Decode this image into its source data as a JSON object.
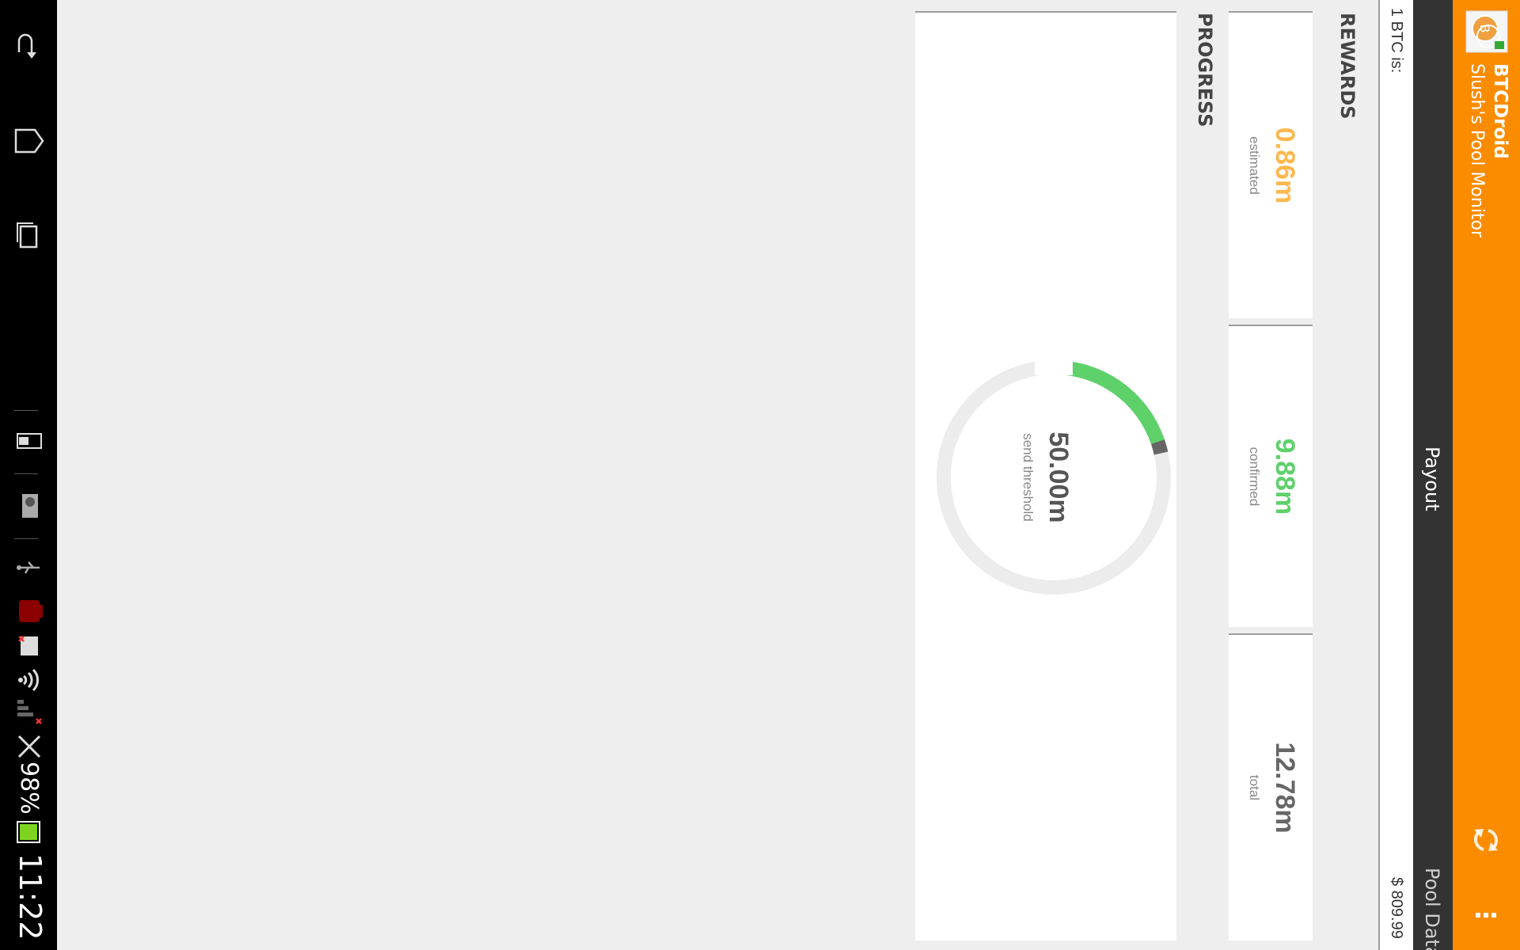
{
  "app": {
    "title": "BTCDroid",
    "subtitle": "Slush's Pool Monitor",
    "accent_color": "#fb8c00",
    "icons": [
      "bitcoin-logo-icon",
      "refresh-icon",
      "overflow-menu-icon"
    ]
  },
  "tabs": [
    {
      "label": "Payout",
      "selected": true
    },
    {
      "label": "Pool Data",
      "selected": false
    }
  ],
  "price": {
    "label": "1 BTC is:",
    "value": "$ 809.99"
  },
  "rewards": {
    "title": "REWARDS",
    "estimated": {
      "value": "0.86m",
      "label": "estimated",
      "color": "#ffb74d"
    },
    "confirmed": {
      "value": "9.88m",
      "label": "confirmed",
      "color": "#5ed16a"
    },
    "total": {
      "value": "12.78m",
      "label": "total",
      "color": "#666666"
    }
  },
  "progress": {
    "title": "PROGRESS",
    "threshold_value": "50.00m",
    "threshold_label": "send threshold",
    "confirmed_fraction": 0.1976,
    "estimated_fraction": 0.0172,
    "confirmed_color": "#5ed16a",
    "estimated_color": "#666666",
    "track_color": "#ececec"
  },
  "system": {
    "time": "11:22",
    "battery": "98%",
    "icons": [
      "back-icon",
      "home-icon",
      "recent-apps-icon",
      "usb-icon",
      "wifi-icon",
      "signal-icon",
      "battery-icon"
    ]
  }
}
